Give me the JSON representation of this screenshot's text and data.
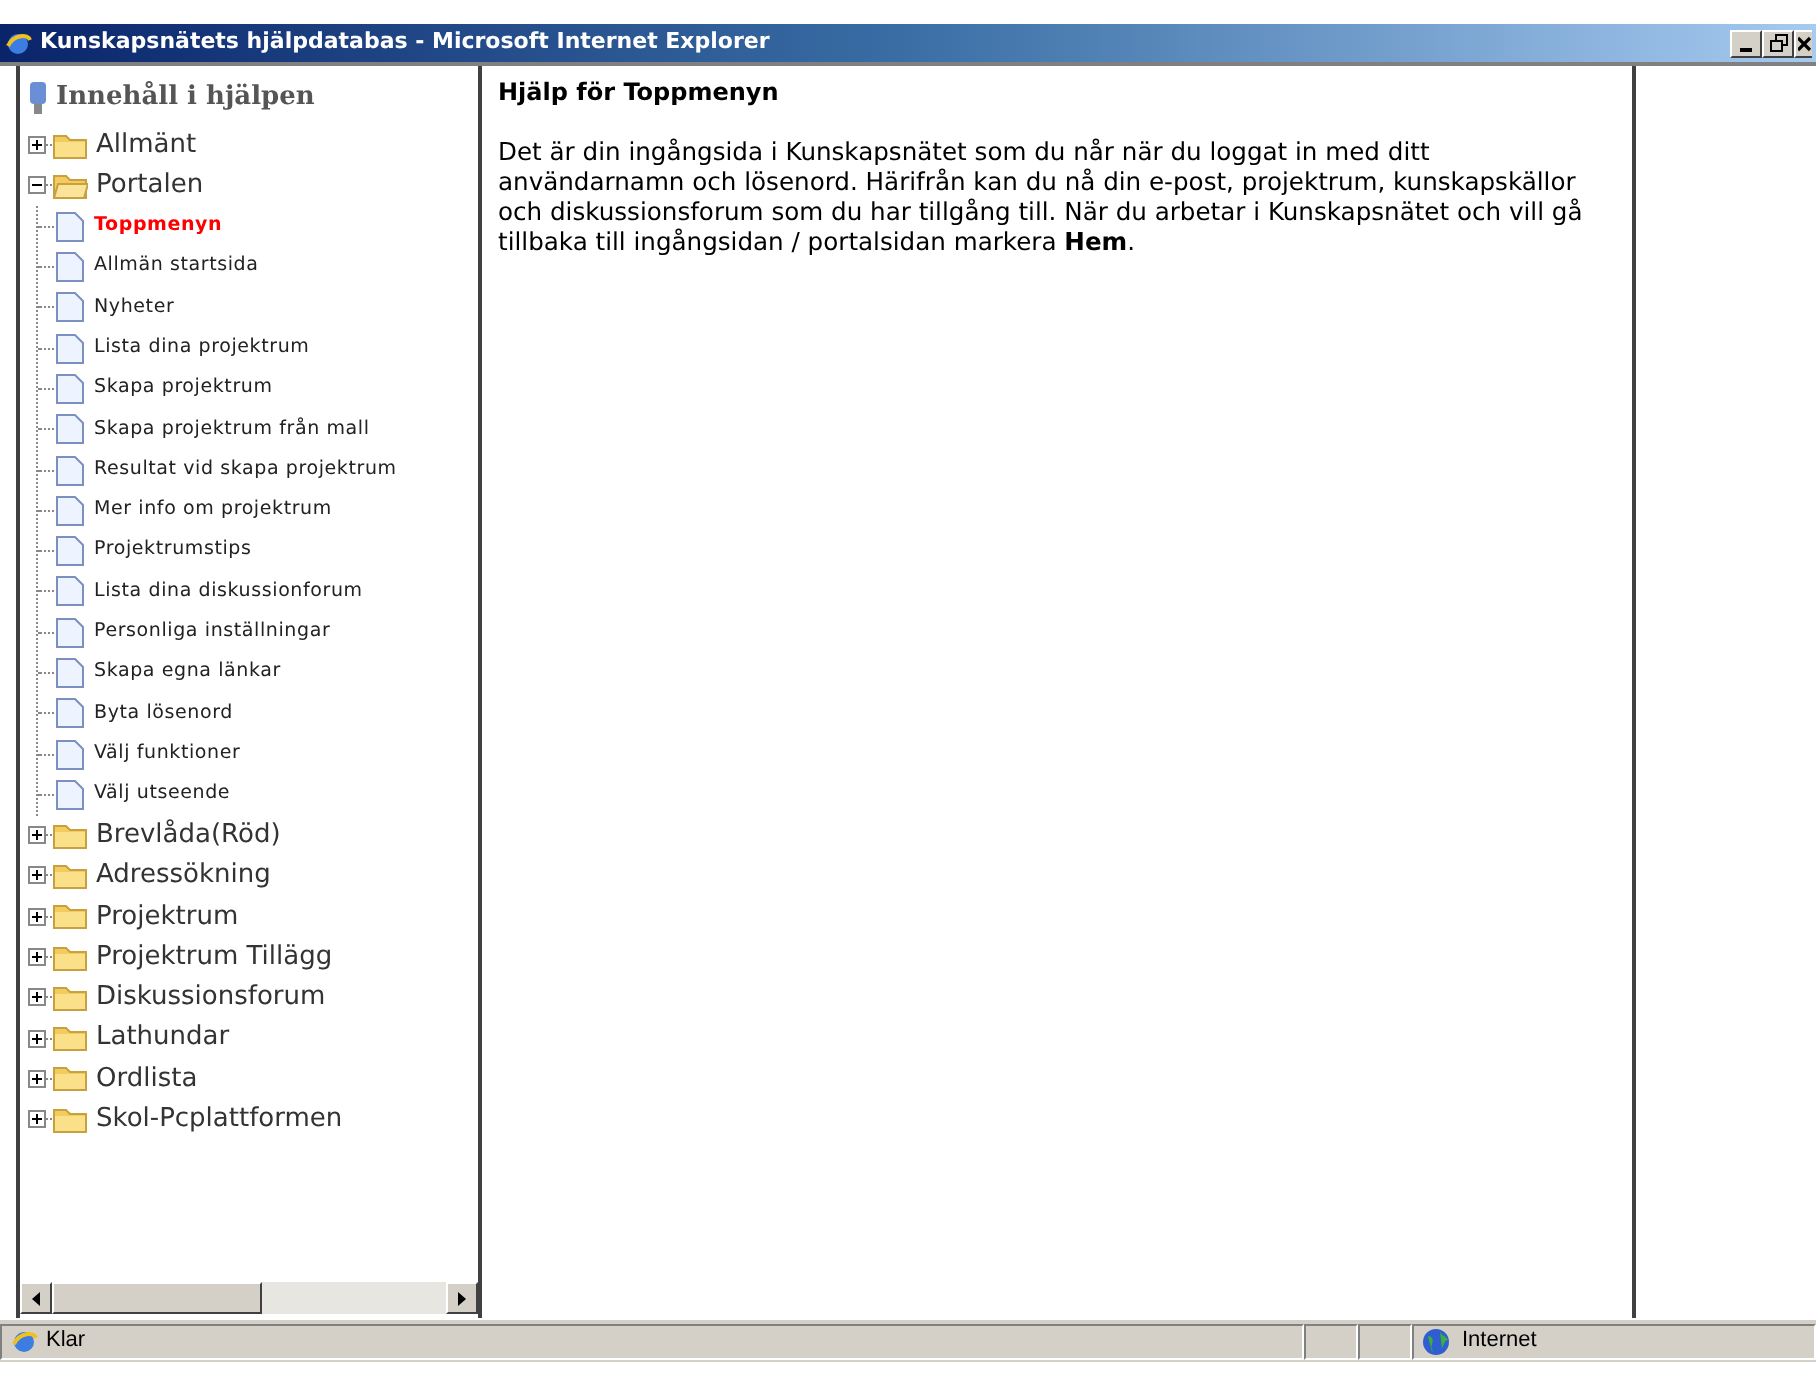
{
  "window": {
    "title": "Kunskapsnätets hjälpdatabas - Microsoft Internet Explorer"
  },
  "tree": {
    "heading": "Innehåll i hjälpen",
    "items": [
      {
        "label": "Allmänt",
        "expanded": false
      },
      {
        "label": "Portalen",
        "expanded": true,
        "children": [
          {
            "label": "Toppmenyn",
            "selected": true
          },
          {
            "label": "Allmän startsida",
            "selected": false
          },
          {
            "label": "Nyheter",
            "selected": false
          },
          {
            "label": "Lista dina projektrum",
            "selected": false
          },
          {
            "label": "Skapa projektrum",
            "selected": false
          },
          {
            "label": "Skapa projektrum från mall",
            "selected": false
          },
          {
            "label": "Resultat vid skapa projektrum",
            "selected": false
          },
          {
            "label": "Mer info om projektrum",
            "selected": false
          },
          {
            "label": "Projektrumstips",
            "selected": false
          },
          {
            "label": "Lista dina diskussionforum",
            "selected": false
          },
          {
            "label": "Personliga inställningar",
            "selected": false
          },
          {
            "label": "Skapa egna länkar",
            "selected": false
          },
          {
            "label": "Byta lösenord",
            "selected": false
          },
          {
            "label": "Välj funktioner",
            "selected": false
          },
          {
            "label": "Välj utseende",
            "selected": false
          }
        ]
      },
      {
        "label": "Brevlåda(Röd)",
        "expanded": false
      },
      {
        "label": "Adressökning",
        "expanded": false
      },
      {
        "label": "Projektrum",
        "expanded": false
      },
      {
        "label": "Projektrum Tillägg",
        "expanded": false
      },
      {
        "label": "Diskussionsforum",
        "expanded": false
      },
      {
        "label": "Lathundar",
        "expanded": false
      },
      {
        "label": "Ordlista",
        "expanded": false
      },
      {
        "label": "Skol-Pcplattformen",
        "expanded": false
      }
    ]
  },
  "content": {
    "heading": "Hjälp för Toppmenyn",
    "paragraph": "Det är din ingångsida i Kunskapsnätet som du når när du loggat in med ditt användarnamn och lösenord. Härifrån kan du nå din e-post, projektrum, kunskapskällor och diskussionsforum som du har tillgång till. När du arbetar i Kunskapsnätet och vill gå tillbaka till ingångsidan / portalsidan markera **Hem**."
  },
  "status_bar": {
    "text": "Klar",
    "zone": "Internet"
  }
}
